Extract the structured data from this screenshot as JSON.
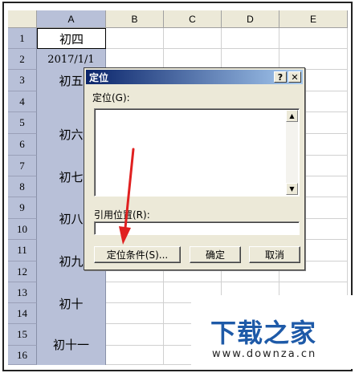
{
  "sheet": {
    "columns": [
      "A",
      "B",
      "C",
      "D",
      "E"
    ],
    "rows": [
      "1",
      "2",
      "3",
      "4",
      "5",
      "6",
      "7",
      "8",
      "9",
      "10",
      "11",
      "12",
      "13",
      "14",
      "15",
      "16"
    ],
    "column_a": {
      "r1": "初四",
      "r2": "2017/1/1",
      "r3": "初五",
      "r5": "初六",
      "r7": "初七",
      "r9": "初八",
      "r11": "初九",
      "r13": "初十",
      "r15": "初十一"
    }
  },
  "dialog": {
    "title": "定位",
    "help_button": "?",
    "close_button": "✕",
    "goto_label": "定位(G):",
    "reference_label": "引用位置(R):",
    "reference_value": "",
    "special_button": "定位条件(S)...",
    "ok_button": "确定",
    "cancel_button": "取消",
    "scroll_up": "▲",
    "scroll_down": "▼"
  },
  "watermark": {
    "title": "下载之家",
    "url": "www.downza.cn"
  },
  "colors": {
    "selection": "#b8c0d8",
    "annotation_arrow": "#e02020",
    "watermark_blue": "#1e5aa8"
  }
}
